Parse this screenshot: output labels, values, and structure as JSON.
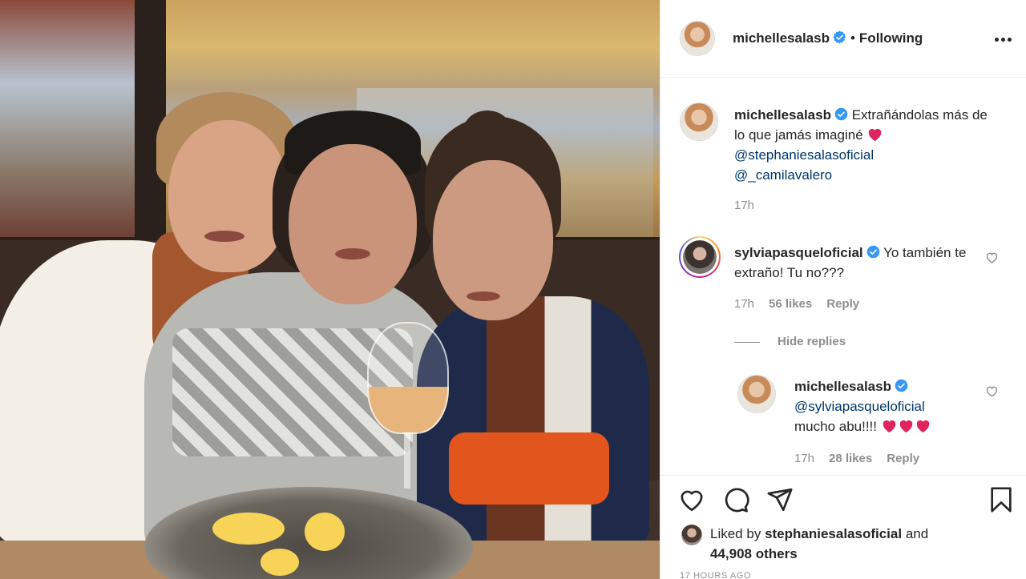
{
  "post": {
    "author": "michellesalasb",
    "follow_status": "Following",
    "dot": "•",
    "caption_text": "Extrañándolas más de lo que jamás imaginé",
    "caption_mentions": [
      "@stephaniesalasoficial",
      "@_camilavalero"
    ],
    "caption_time": "17h"
  },
  "comments": [
    {
      "user": "sylviapasqueloficial",
      "text": "Yo también te extraño! Tu no???",
      "time": "17h",
      "likes": "56 likes",
      "reply": "Reply",
      "hide_replies": "Hide replies",
      "replies": [
        {
          "user": "michellesalasb",
          "mention": "@sylviapasqueloficial",
          "text": "mucho abu!!!!",
          "time": "17h",
          "likes": "28 likes",
          "reply": "Reply"
        }
      ]
    }
  ],
  "likes": {
    "prefix": "Liked by",
    "user": "stephaniesalasoficial",
    "and": "and",
    "others": "44,908 others"
  },
  "timestamp": "17 HOURS AGO",
  "colors": {
    "verified": "#3897f0",
    "heart": "#ed4956",
    "link": "#00376b",
    "muted": "#8e8e8e"
  },
  "icons": [
    "more-options-icon",
    "verified-icon",
    "heart-icon",
    "comment-icon",
    "share-icon",
    "bookmark-icon"
  ]
}
